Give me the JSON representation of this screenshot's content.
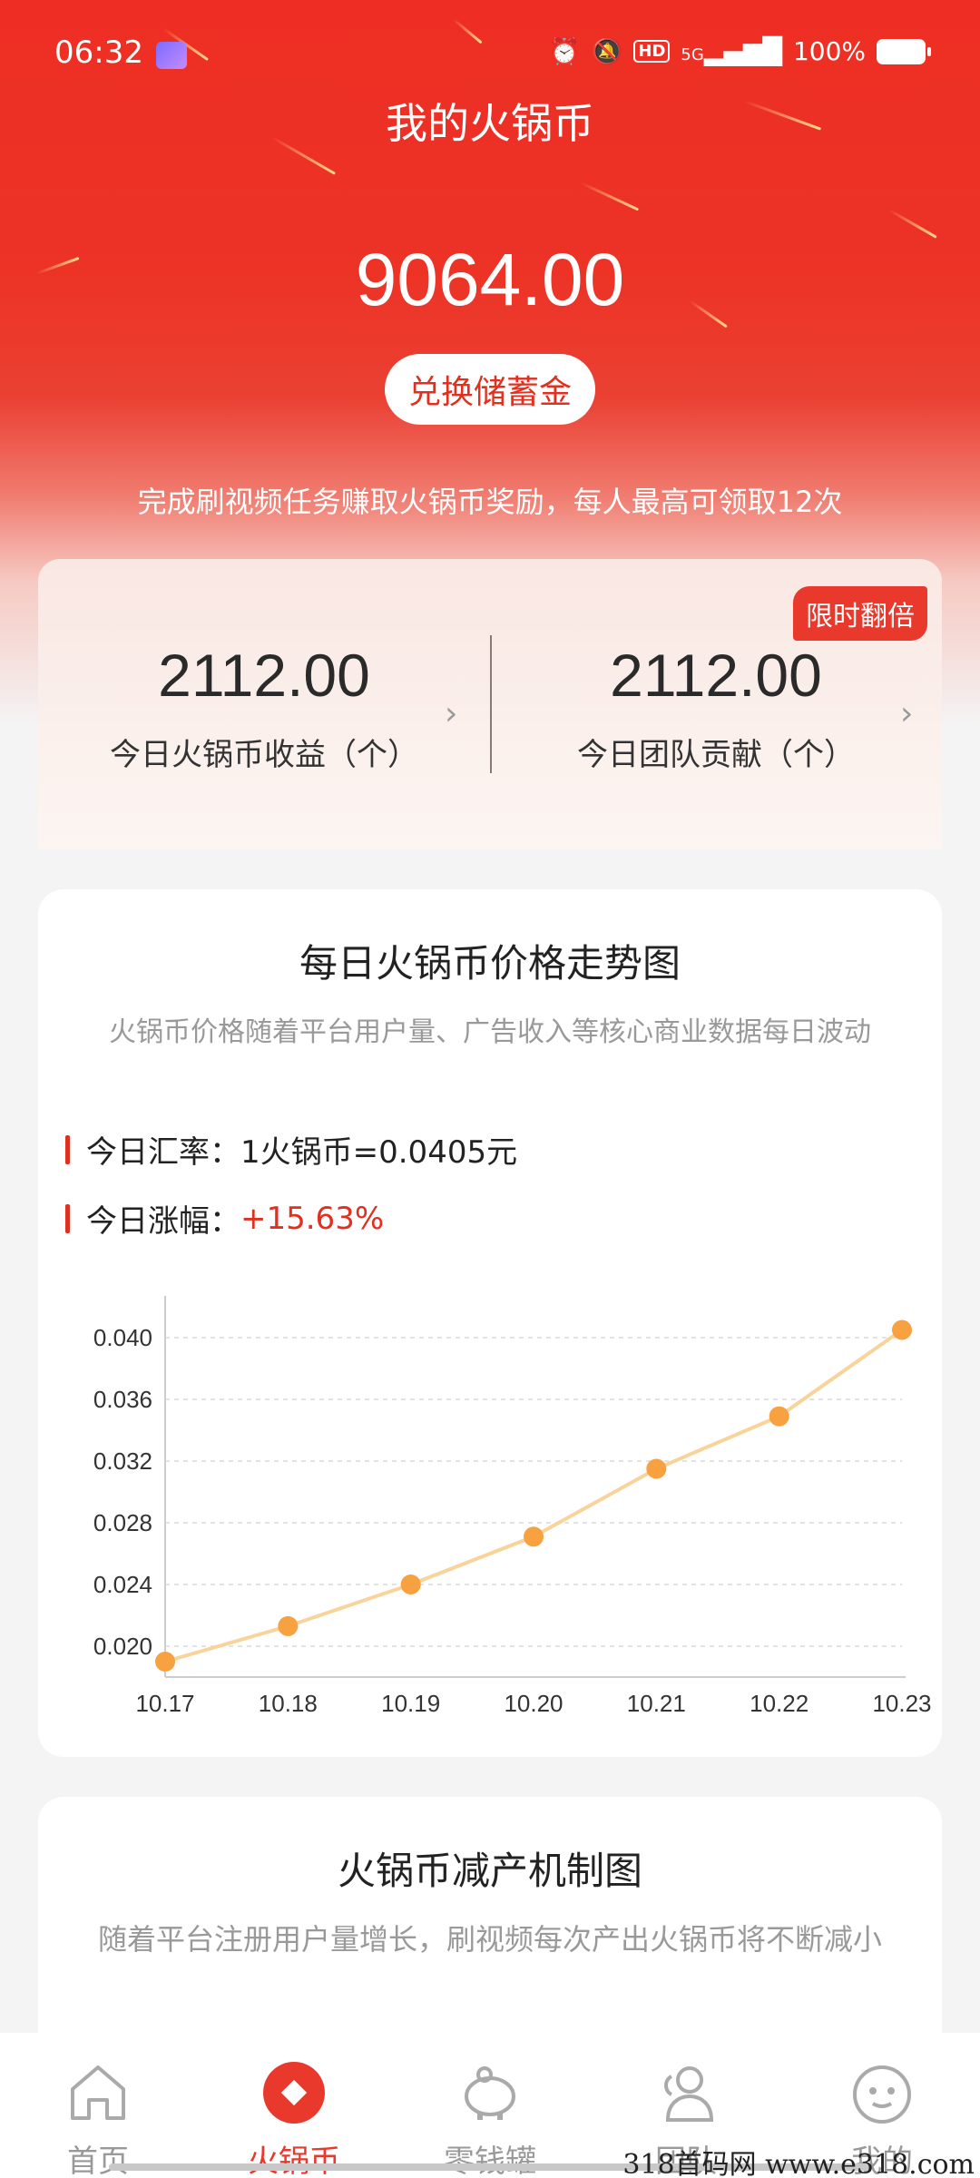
{
  "status_bar": {
    "time": "06:32",
    "network": "5G",
    "battery": "100%",
    "icons": [
      "alarm-icon",
      "mute-icon",
      "hd-icon",
      "signal-icon",
      "battery-icon"
    ]
  },
  "header": {
    "title": "我的火锅币",
    "balance": "9064.00",
    "exchange_button": "兑换储蓄金",
    "hint": "完成刷视频任务赚取火锅币奖励，每人最高可领取12次"
  },
  "stats": {
    "badge": "限时翻倍",
    "today_income_value": "2112.00",
    "today_income_label": "今日火锅币收益（个）",
    "team_value": "2112.00",
    "team_label": "今日团队贡献（个）"
  },
  "trend_card": {
    "title": "每日火锅币价格走势图",
    "subtitle": "火锅币价格随着平台用户量、广告收入等核心商业数据每日波动",
    "rate_label": "今日汇率：",
    "rate_value": "1火锅币=0.0405元",
    "change_label": "今日涨幅：",
    "change_value": "+15.63%"
  },
  "chart_data": {
    "type": "line",
    "categories": [
      "10.17",
      "10.18",
      "10.19",
      "10.20",
      "10.21",
      "10.22",
      "10.23"
    ],
    "values": [
      0.019,
      0.0213,
      0.024,
      0.0271,
      0.0315,
      0.0349,
      0.0405
    ],
    "ylim": [
      0.018,
      0.042
    ],
    "yticks": [
      "0.040",
      "0.036",
      "0.032",
      "0.028",
      "0.024",
      "0.020"
    ],
    "ytick_values": [
      0.04,
      0.036,
      0.032,
      0.028,
      0.024,
      0.02
    ],
    "title": "",
    "xlabel": "",
    "ylabel": "",
    "grid": "dashed horizontal",
    "line_color": "#f8d49a",
    "point_color": "#f7a141"
  },
  "mechanism_card": {
    "title": "火锅币减产机制图",
    "subtitle": "随着平台注册用户量增长，刷视频每次产出火锅币将不断减小"
  },
  "tabbar": {
    "items": [
      {
        "label": "首页",
        "icon": "home-icon"
      },
      {
        "label": "火锅币",
        "icon": "hotpot-coin-icon"
      },
      {
        "label": "零钱罐",
        "icon": "piggy-bank-icon"
      },
      {
        "label": "团队",
        "icon": "team-icon"
      },
      {
        "label": "我的",
        "icon": "profile-icon"
      }
    ],
    "active": "火锅币"
  },
  "watermark": "318首码网  www.e318.com",
  "colors": {
    "brand_red": "#e8392c",
    "accent_orange": "#f7a141"
  }
}
